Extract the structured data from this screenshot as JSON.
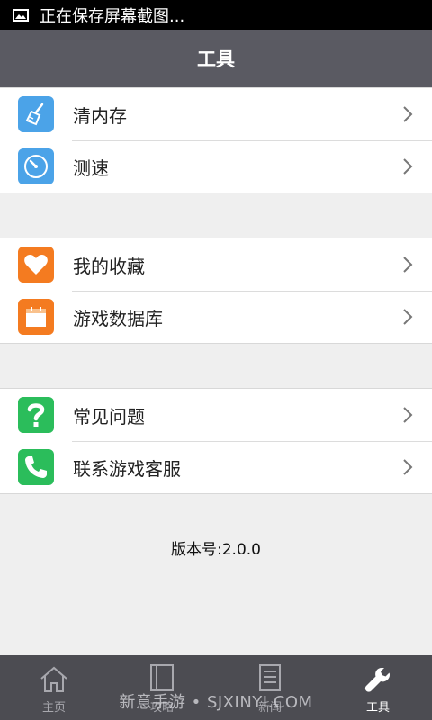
{
  "status_bar": {
    "text": "正在保存屏幕截图...",
    "icon": "screenshot-icon"
  },
  "header": {
    "title": "工具"
  },
  "groups": [
    {
      "items": [
        {
          "label": "清内存",
          "icon": "broom-icon",
          "color": "#4ba3e8"
        },
        {
          "label": "测速",
          "icon": "speedometer-icon",
          "color": "#4ba3e8"
        }
      ]
    },
    {
      "items": [
        {
          "label": "我的收藏",
          "icon": "heart-icon",
          "color": "#f47b20"
        },
        {
          "label": "游戏数据库",
          "icon": "database-box-icon",
          "color": "#f47b20"
        }
      ]
    },
    {
      "items": [
        {
          "label": "常见问题",
          "icon": "question-icon",
          "color": "#2bbd5b"
        },
        {
          "label": "联系游戏客服",
          "icon": "phone-icon",
          "color": "#2bbd5b"
        }
      ]
    }
  ],
  "version": "版本号:2.0.0",
  "tabs": [
    {
      "label": "主页",
      "icon": "home-icon",
      "active": false
    },
    {
      "label": "攻略",
      "icon": "book-icon",
      "active": false
    },
    {
      "label": "新闻",
      "icon": "news-icon",
      "active": false
    },
    {
      "label": "工具",
      "icon": "wrench-icon",
      "active": true
    }
  ],
  "watermark": "新意手游 • SJXINYI.COM"
}
